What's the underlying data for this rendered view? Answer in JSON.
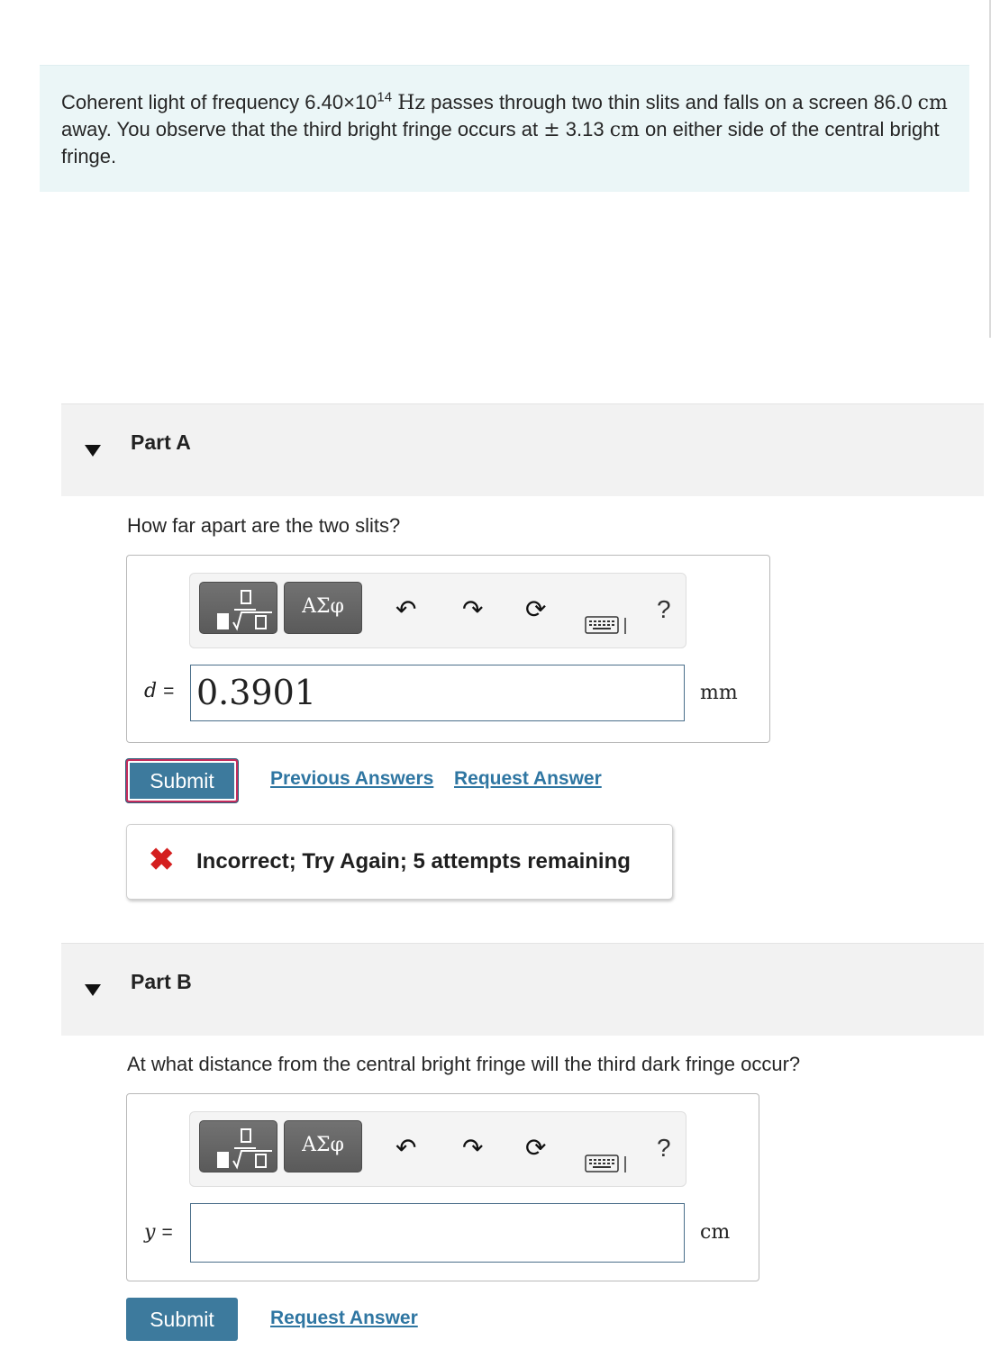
{
  "problem": {
    "text_1": "Coherent light of frequency 6.40×10",
    "text_exp": "14",
    "unit_hz": "Hz",
    "text_2": " passes through two thin slits and falls on a screen 86.0 ",
    "unit_cm_1": "cm",
    "text_3": " away. You observe that the third bright fringe occurs at ",
    "pm": "±",
    "text_4": " 3.13 ",
    "unit_cm_2": "cm",
    "text_5": " on either side of the central bright fringe."
  },
  "toolbar": {
    "templates_icon": "templates-icon",
    "greek_label": "ΑΣφ",
    "undo_icon": "↶",
    "redo_icon": "↷",
    "reset_icon": "⟳",
    "keyboard_icon": "⌨",
    "help_label": "?"
  },
  "partA": {
    "title": "Part A",
    "question": "How far apart are the two slits?",
    "variable": "d",
    "equals": "=",
    "value": "0.3901",
    "unit": "mm",
    "submit_label": "Submit",
    "previous_answers_label": "Previous Answers",
    "request_answer_label": "Request Answer",
    "feedback_icon": "✖",
    "feedback_text": "Incorrect; Try Again; 5 attempts remaining"
  },
  "partB": {
    "title": "Part B",
    "question": "At what distance from the central bright fringe will the third dark fringe occur?",
    "variable": "y",
    "equals": "=",
    "value": "",
    "unit": "cm",
    "submit_label": "Submit",
    "request_answer_label": "Request Answer"
  },
  "colors": {
    "problem_bg": "#ebf6f7",
    "submit_bg": "#3d7a9d",
    "link": "#2f76a2",
    "error": "#d41f1f"
  }
}
